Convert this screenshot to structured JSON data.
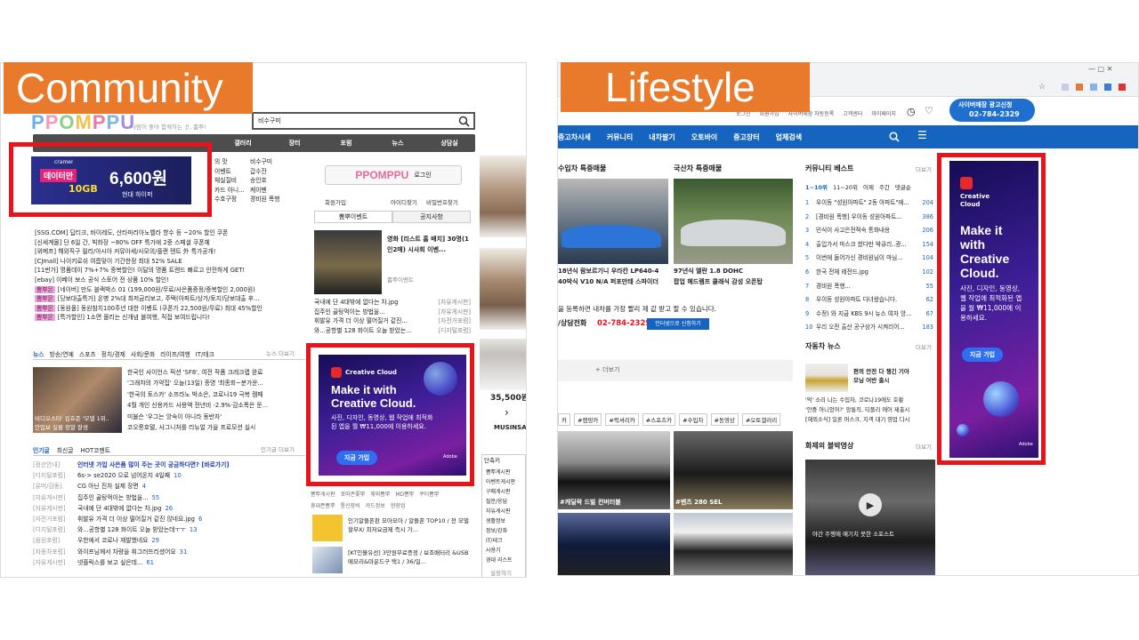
{
  "labels": {
    "community": "Community",
    "lifestyle": "Lifestyle"
  },
  "colors": {
    "accent": "#e97a2b",
    "highlight": "#e8141b",
    "blue": "#1565c0",
    "ppomppu_dark": "#4a4a4a"
  },
  "community": {
    "search_value": "비수구미",
    "tagline": "사람이 좋아 함께하는 곳, 뽐뿌!",
    "nav": [
      "갤러리",
      "장터",
      "포럼",
      "뉴스",
      "상담실"
    ],
    "menu_right": [
      "비수구미",
      "갑수잔",
      "송인호",
      "케이펜",
      "경비원 폭행"
    ],
    "menu_left": [
      "의 맛",
      "이벤트",
      "체실질비",
      "카드 아니...",
      "수호구정"
    ],
    "ad_banner": {
      "brand": "cramer",
      "price": "6,600원",
      "tag": "데이터만",
      "gb": "10GB",
      "tagline": "현대 하이퍼"
    },
    "login_label": "로그인",
    "login_links": [
      "회원가입",
      "아이디찾기",
      "비밀번호찾기"
    ],
    "tabs": [
      "뽐뿌이벤트",
      "공지사항"
    ],
    "deals": [
      "[SSG.COM] 딥티크, 바이레도, 산타마리아노벨라 향수 등 ~20% 할인 쿠폰",
      "[신세계몰] 단 6일 간, 빅화장 ~80% OFF 특가에 2중 스페셜 쿠폰혜",
      "[위메프] 해외직구 필리/아시아 커뮤아세/사모의/플랜 텐트 外 특가공개!",
      "[CJmall] 나이키로쉬 여름맞이 기간한정 최대 52% SALE",
      "[11번가] 명품데이 7%+7% 중복할인! 이달의 명품 트렌드 빠르고 안전하게 GET!",
      "[ebay] 이베이 보스 공식 스토어 전 상품 10% 할인!",
      "[네이버] 만도 블랙박스 01 (199,000원/무료/사은품증정/중복할인 2,000원)",
      "[당보대출특가] 온병 2%대 최저금리보고, 주택(아파트/상가/토지)당보대출 후...",
      "[동원몰] 동원참치100주년 대한 이벤트 (쿠폰가 22,500원/무료) 최대 45%할인",
      "[특가할인] 1소면 몰리는 신개념 볼여행, 직접 보여드립니다!"
    ],
    "deal_badge": "뽐뿌몬",
    "news_tabs": [
      "뉴스",
      "방송/연예",
      "스포츠",
      "정치/경제",
      "사회/문화",
      "라이프/여행",
      "IT/테크"
    ],
    "news_more": "뉴스 더보기",
    "news": [
      "한국인 사이언스 픽션 'SF8', 여전 작품 크레크랩 완료",
      "'그래챠의 가약집' 오늘(13일) 종영 '최종회~분가운...",
      "'한국의 토스카' 소프라노 박소은, 코로나19 극복 캠페",
      "4월 개인 신용카드 사용액 전년비 -2.9%·감소폭은 둔...",
      "미불슨 '우그는 앙숙이 아니라 동반자'",
      "코오롱호텔, 사그니처를 리뉴얼 가을 프로모션 실시"
    ],
    "news_thumb": [
      "비디오스타' 김효준 '모델 1위..",
      "안입보 실물 정말 잘생"
    ],
    "hot_tabs": [
      "인기글",
      "최신글",
      "HOT코멘트"
    ],
    "hot_more": "인기글 더보기",
    "hot": [
      {
        "cat": "[정산안내]",
        "title": "인터넷 가입 사은품 많이 주는 곳이 궁금하다면? [바로가기]",
        "n": ""
      },
      {
        "cat": "[디지털포럼]",
        "title": "6s-> se2020 으로 넘어온지 4일째",
        "n": "10"
      },
      {
        "cat": "[유머/감동]",
        "title": "CG 아닌 진차 실제 장면",
        "n": "4"
      },
      {
        "cat": "[자유게시판]",
        "title": "집주인 골탕먹이는 방법을...",
        "n": "55"
      },
      {
        "cat": "[자유게시판]",
        "title": "국내에 단 4대밖에 없다는 차.jpg",
        "n": "26"
      },
      {
        "cat": "[자전거포럼]",
        "title": "휘발유 가격 더 이상 떨어질거 같진 않네요.jpg",
        "n": "6"
      },
      {
        "cat": "[디지털포럼]",
        "title": "와...공항별 128 화이트 오늘 받았는데ㅜㅜ",
        "n": "13"
      },
      {
        "cat": "[음원포럼]",
        "title": "우한에서 코로나 재발했네요",
        "n": "29"
      },
      {
        "cat": "[자동차포럼]",
        "title": "와이프님께서 차량을 휘그러뜨리셨어요",
        "n": "31"
      },
      {
        "cat": "[자유게시판]",
        "title": "넷플릭스를 보고 싶은데...",
        "n": "61"
      }
    ],
    "feature_title": "영화 [리스트 홈 배치] 30명(1인2매) 시사회 이벤...",
    "feature_sub": "뽐뿌이벤트",
    "feature_list": [
      {
        "t": "국내에 단 4대밖에 없다는 차.jpg",
        "c": "[자유게시판]"
      },
      {
        "t": "집주인 골탕먹이는 방법을...",
        "c": "[자유게시판]"
      },
      {
        "t": "휘발유 가격 더 이상 떨어질거 같진...",
        "c": "[자전거포럼]"
      },
      {
        "t": "와...공항별 128 화이트 오늘 받았는...",
        "c": "[디지털포럼]"
      }
    ],
    "ad": {
      "brand": "Creative Cloud",
      "headline": "Make it with Creative Cloud.",
      "body": "사진, 디자인, 동영상, 웹 작업에 최적화된 앱을 월 ₩11,000에 이용하세요.",
      "cta": "지금 가입",
      "adobe": "Adobe"
    },
    "bottom_links": [
      "뽐뿌게시판",
      "포마존쫓뿌",
      "해외뽐뿌",
      "MD뽐뿌",
      "쿠티뽐뿌"
    ],
    "bottom_links2": [
      "휴대폰뽐뿌",
      "통신장비",
      "카드정보",
      "현장업"
    ],
    "promo": [
      "인기알뜰폰판 모아모아 / 알뜰폰 TOP10 / 전 모델 할부X/ 최저요금제 즉시 가...",
      "[KT인볼유선] 3만원무료증정 / 보조배터리 &USB메모리&마운드구 택1 / 36/일..."
    ],
    "price": "35,500원",
    "musinsa": "MUSINSA",
    "shortcut_tabs": [
      "단축키",
      "세"
    ],
    "shortcuts": [
      "뽐뿌게시판",
      "아벤트게시판",
      "구매게시판",
      "질문/응답",
      "자유게시판",
      "생활정보",
      "정보/강좌",
      "IT/테크",
      "사용기",
      "경대 리스트"
    ],
    "settings": "설정하기"
  },
  "lifestyle": {
    "top_links": [
      "로그인",
      "회원가입",
      "사이버매장 자동등록",
      "고객센터",
      "마이페이지"
    ],
    "ad_line": "사이버매장 광고신청",
    "phone": "02-784-2329",
    "nav": [
      "중고차시세",
      "커뮤니티",
      "내차팔기",
      "오토바이",
      "중고장터",
      "업체검색"
    ],
    "imported_title": "수입차 특증매물",
    "domestic_title": "국산차 특증매물",
    "imported_car": [
      "18년식 람보르기니 우라칸 LP640-4",
      "40박식 V10 N/A 퍼포만태 스파이더"
    ],
    "domestic_car": [
      "97년식 엘란 1.8 DOHC",
      "팝업 헤드램프 클래식 감성 오픈탑"
    ],
    "register_text": "을 등록하면 내차를 가장 빨리 제 값 받고 팔 수 있습니다.",
    "consult_label": "/상담전화",
    "consult_phone": "02-784-2329",
    "consult_btn": "인터넷으로 신청하기",
    "more": "+ 더보기",
    "hashtags": [
      "#캠핑카",
      "#럭셔리카",
      "#스포츠카",
      "#수입차",
      "#동영상",
      "#오토갤러리"
    ],
    "hashtag_head": "카",
    "photo_captions": [
      "#캐딜락 드빌 컨버터블",
      "#벤츠 280 SEL"
    ],
    "community_best": "커뮤니티 베스트",
    "more_link": "더보기",
    "best_tabs": [
      "1~10위",
      "11~20위",
      "어제",
      "주간",
      "댓글순"
    ],
    "best": [
      {
        "n": "1",
        "t": "우이동 \"성원아파트\" 2동 아파트\"에...",
        "c": "204"
      },
      {
        "n": "2",
        "t": "[경비원 폭행] 우이동 성원아파트...",
        "c": "386"
      },
      {
        "n": "3",
        "t": "민식이 사고은전적숙 통화내용",
        "c": "206"
      },
      {
        "n": "4",
        "t": "출입가서 마스크 썼다만 박큐리..광...",
        "c": "154"
      },
      {
        "n": "5",
        "t": "이번에 들어가신 경비원님이 마님...",
        "c": "104"
      },
      {
        "n": "6",
        "t": "한국 전체 레전드.jpg",
        "c": "102"
      },
      {
        "n": "7",
        "t": "경비원 폭행...",
        "c": "55"
      },
      {
        "n": "8",
        "t": "우이동 성원아파트 다녀왔습니다.",
        "c": "62"
      },
      {
        "n": "9",
        "t": "수정) 와 지금 KBS 9시 뉴스 여자 앙...",
        "c": "67"
      },
      {
        "n": "10",
        "t": "우리 오전 출산 공구상가 시켜리어...",
        "c": "183"
      }
    ],
    "car_news": "자동차 뉴스",
    "car_news_items": [
      "편의 안전 다 챙긴 기아 모닝 어반 출시",
      "'억' 소리 나는 수입차, 코로나19에도 호황",
      "'안중 아니었어?' 앙통직, 티플리 에어 제출시",
      "[해외소식] 일론 머스크, 지객 대기 영업 다시"
    ],
    "video_title": "화제의 블박영상",
    "video_caption": "야간 주행에 예기치 못한 소포스트",
    "ad": {
      "brand": "Creative Cloud",
      "headline": "Make it with Creative Cloud.",
      "body": "사진, 디자인, 동영상, 웹 작업에 최적화된 앱을 월 ₩11,000에 이용하세요.",
      "cta": "지금 가입",
      "adobe": "Adobe"
    }
  }
}
